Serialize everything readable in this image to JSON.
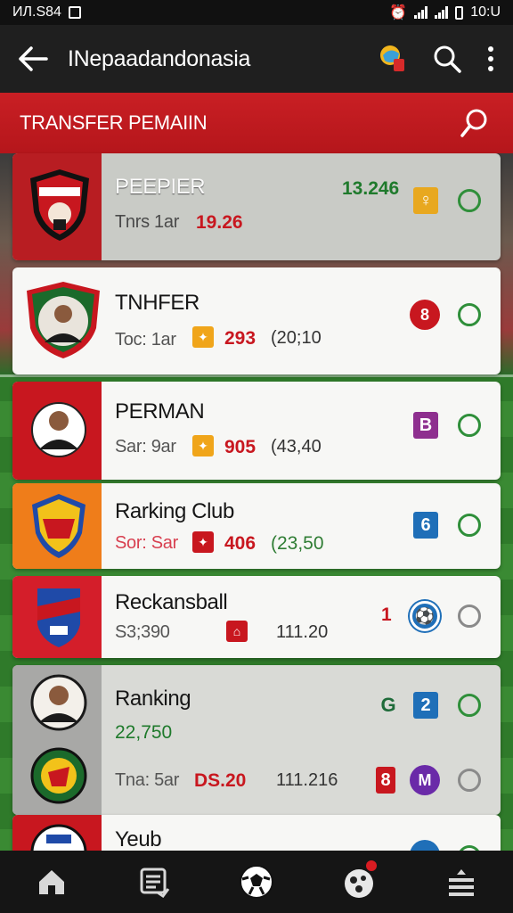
{
  "status_bar": {
    "carrier": "ИЛ.S84",
    "time": "10:U"
  },
  "app_bar": {
    "title": "INepaadandonasia",
    "back_icon": "arrow-left-icon",
    "icons": [
      "trophy-icon",
      "search-icon",
      "more-vert-icon"
    ]
  },
  "section": {
    "title": "TRANSFER PEMAIIN",
    "icon": "search-icon"
  },
  "colors": {
    "header_red": "#c91f24",
    "appbar": "#1f1f1f",
    "green": "#1f7a2c",
    "red_value": "#c8171f"
  },
  "cards": [
    {
      "name": "PEEPIER",
      "sub": "Tnrs 1ar",
      "value": "19.26",
      "top_value": "13.246",
      "badge": "♀",
      "badge_color": "#e8a81f"
    },
    {
      "name": "TNHFER",
      "sub": "Toc: 1ar",
      "value": "293",
      "secondary": "(20;10",
      "badge": "8",
      "badge_color": "#c8171f"
    },
    {
      "name": "PERMAN",
      "sub": "Sar: 9ar",
      "value": "905",
      "secondary": "(43,40",
      "badge": "B",
      "badge_color": "#8e2f8f"
    },
    {
      "name": "Rarking Club",
      "sub": "Sor: Sar",
      "value": "406",
      "secondary": "(23,50",
      "badge": "6",
      "badge_color": "#1f6fb8"
    },
    {
      "name": "Reckansball",
      "sub": "S3;390",
      "value": "1",
      "secondary": "111.20",
      "badge": "⚽",
      "badge_color": "#1f6fb8"
    },
    {
      "name": "Ranking",
      "sub": "22,750",
      "row2_sub": "Tna: 5ar",
      "value": "DS.20",
      "secondary": "111.216",
      "badge_a": "G",
      "badge_b": "2",
      "badge_c": "8",
      "badge_d": "M"
    },
    {
      "name": "Yeub"
    }
  ],
  "bottom_nav": [
    "home-icon",
    "list-icon",
    "soccer-ball-icon",
    "club-icon",
    "menu-icon"
  ]
}
